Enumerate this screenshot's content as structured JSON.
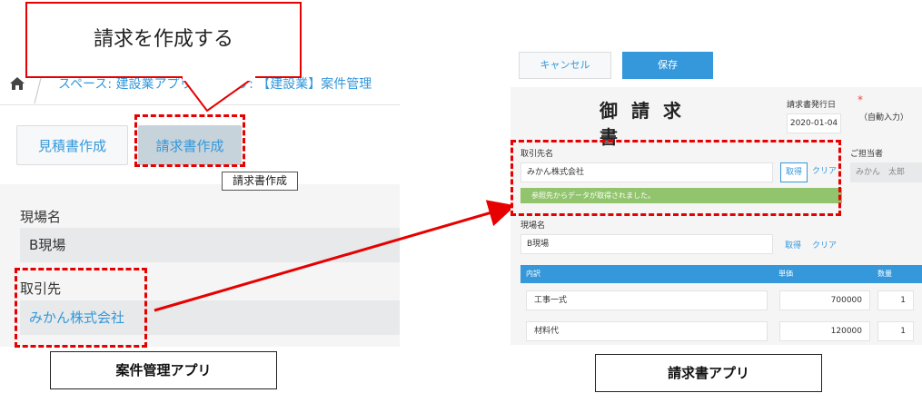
{
  "callout": {
    "text": "請求を作成する"
  },
  "case_app": {
    "breadcrumb": "スペース: 建設業アプリ > アプリ: 【建設業】案件管理",
    "buttons": {
      "estimate": "見積書作成",
      "invoice": "請求書作成"
    },
    "tooltip": "請求書作成",
    "fields": {
      "site_label": "現場名",
      "site_value": "B現場",
      "client_label": "取引先",
      "client_value": "みかん株式会社"
    },
    "caption": "案件管理アプリ"
  },
  "invoice_app": {
    "toolbar": {
      "cancel": "キャンセル",
      "save": "保存"
    },
    "title": "御 請 求 書",
    "issue_date_label": "請求書発行日",
    "required_mark": "*",
    "auto_input": "（自動入力）",
    "issue_date": "2020-01-04",
    "client_name_label": "取引先名",
    "client_name": "みかん株式会社",
    "fetch": "取得",
    "clear": "クリア",
    "notice": "参照先からデータが取得されました。",
    "staff_label": "ご担当者",
    "staff_value": "みかん　太郎",
    "site_name_label": "現場名",
    "site_name": "B現場",
    "table": {
      "headers": {
        "item": "内訳",
        "unit_price": "単価",
        "qty": "数量"
      },
      "rows": [
        {
          "item": "工事一式",
          "unit_price": "700000",
          "qty": "1"
        },
        {
          "item": "材料代",
          "unit_price": "120000",
          "qty": "1"
        }
      ]
    },
    "caption": "請求書アプリ"
  },
  "colors": {
    "accent": "#3498db",
    "highlight": "#e60000",
    "notice": "#91c46c"
  }
}
